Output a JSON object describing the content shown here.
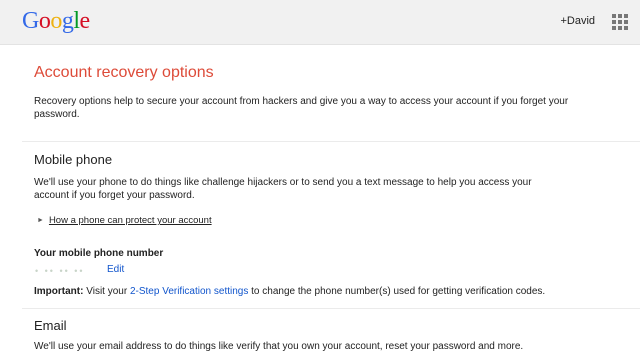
{
  "header": {
    "logo": [
      "G",
      "o",
      "o",
      "g",
      "l",
      "e"
    ],
    "logo_colors": [
      "#3369e8",
      "#d50f25",
      "#eeb211",
      "#3369e8",
      "#009925",
      "#d50f25"
    ],
    "user": "+David",
    "apps_icon": "grid-icon"
  },
  "page": {
    "title": "Account recovery options",
    "intro_line1": "Recovery options help to secure your account from hackers and give you a way to access your account if you forget your",
    "intro_line2": "password."
  },
  "mobile": {
    "heading": "Mobile phone",
    "desc_line1": "We'll use your phone to do things like challenge hijackers or to send you a text message to help you access your",
    "desc_line2": "account if you forget your password.",
    "disclosure": "How a phone can protect your account",
    "number_label": "Your mobile phone number",
    "masked_number": "• •• •• ••",
    "edit": "Edit",
    "important_label": "Important:",
    "important_pre": " Visit your ",
    "important_link": "2-Step Verification settings",
    "important_post": " to change the phone number(s) used for getting verification codes."
  },
  "email": {
    "heading": "Email",
    "desc": "We'll use your email address to do things like verify that you own your account, reset your password and more."
  }
}
